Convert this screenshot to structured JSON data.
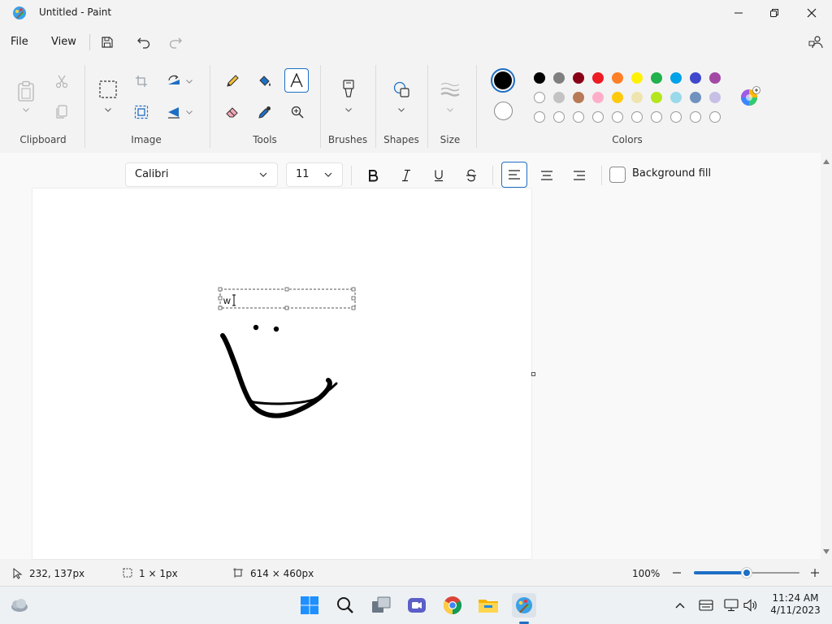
{
  "window": {
    "title": "Untitled - Paint"
  },
  "menu": {
    "file": "File",
    "view": "View"
  },
  "ribbon": {
    "groups": {
      "clipboard": "Clipboard",
      "image": "Image",
      "tools": "Tools",
      "brushes": "Brushes",
      "shapes": "Shapes",
      "size": "Size",
      "colors": "Colors"
    },
    "active_color": "#000000",
    "secondary_color": "#ffffff",
    "palette_row1": [
      "#000000",
      "#7f7f7f",
      "#880015",
      "#ed1c24",
      "#ff7f27",
      "#fff200",
      "#22b14c",
      "#00a2e8",
      "#3f48cc",
      "#a349a4"
    ],
    "palette_row2": [
      "#ffffff",
      "#c3c3c3",
      "#b97a57",
      "#ffaec9",
      "#ffc90e",
      "#efe4b0",
      "#b5e61d",
      "#99d9ea",
      "#7092be",
      "#c8bfe7"
    ]
  },
  "text_toolbar": {
    "font_family": "Calibri",
    "font_size": "11",
    "background_fill_label": "Background fill"
  },
  "canvas": {
    "text_box_content": "w"
  },
  "status": {
    "cursor_position": "232, 137px",
    "selection_size": "1 × 1px",
    "canvas_size": "614 × 460px",
    "zoom": "100%",
    "zoom_level": 0.5
  },
  "taskbar": {
    "time": "11:24 AM",
    "date": "4/11/2023"
  }
}
